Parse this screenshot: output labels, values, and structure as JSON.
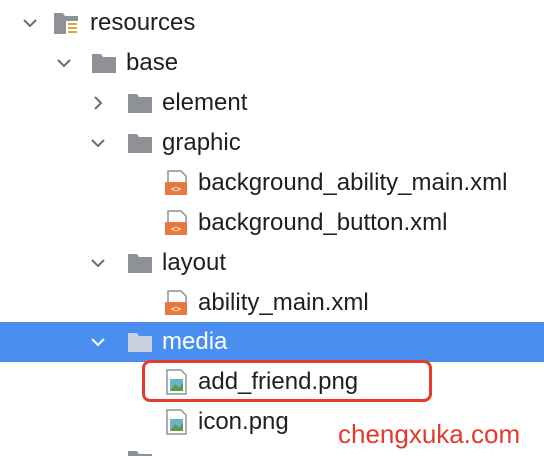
{
  "project_tree": {
    "items": [
      {
        "label": "resources",
        "icon": "resources-folder-icon",
        "expanded": true
      },
      {
        "label": "base",
        "icon": "folder-icon",
        "expanded": true
      },
      {
        "label": "element",
        "icon": "folder-icon",
        "expanded": false
      },
      {
        "label": "graphic",
        "icon": "folder-icon",
        "expanded": true
      },
      {
        "label": "background_ability_main.xml",
        "icon": "xml-file-icon"
      },
      {
        "label": "background_button.xml",
        "icon": "xml-file-icon"
      },
      {
        "label": "layout",
        "icon": "folder-icon",
        "expanded": true
      },
      {
        "label": "ability_main.xml",
        "icon": "xml-file-icon"
      },
      {
        "label": "media",
        "icon": "folder-icon",
        "expanded": true,
        "selected": true
      },
      {
        "label": "add_friend.png",
        "icon": "image-file-icon",
        "highlighted": true
      },
      {
        "label": "icon.png",
        "icon": "image-file-icon"
      }
    ]
  },
  "watermark": {
    "text": "chengxuka.com"
  },
  "colors": {
    "selection": "#4a8ff0",
    "highlight_border": "#e53b2c",
    "folder": "#8e9297",
    "xml_badge": "#e9783c",
    "watermark": "#e43a2a"
  }
}
